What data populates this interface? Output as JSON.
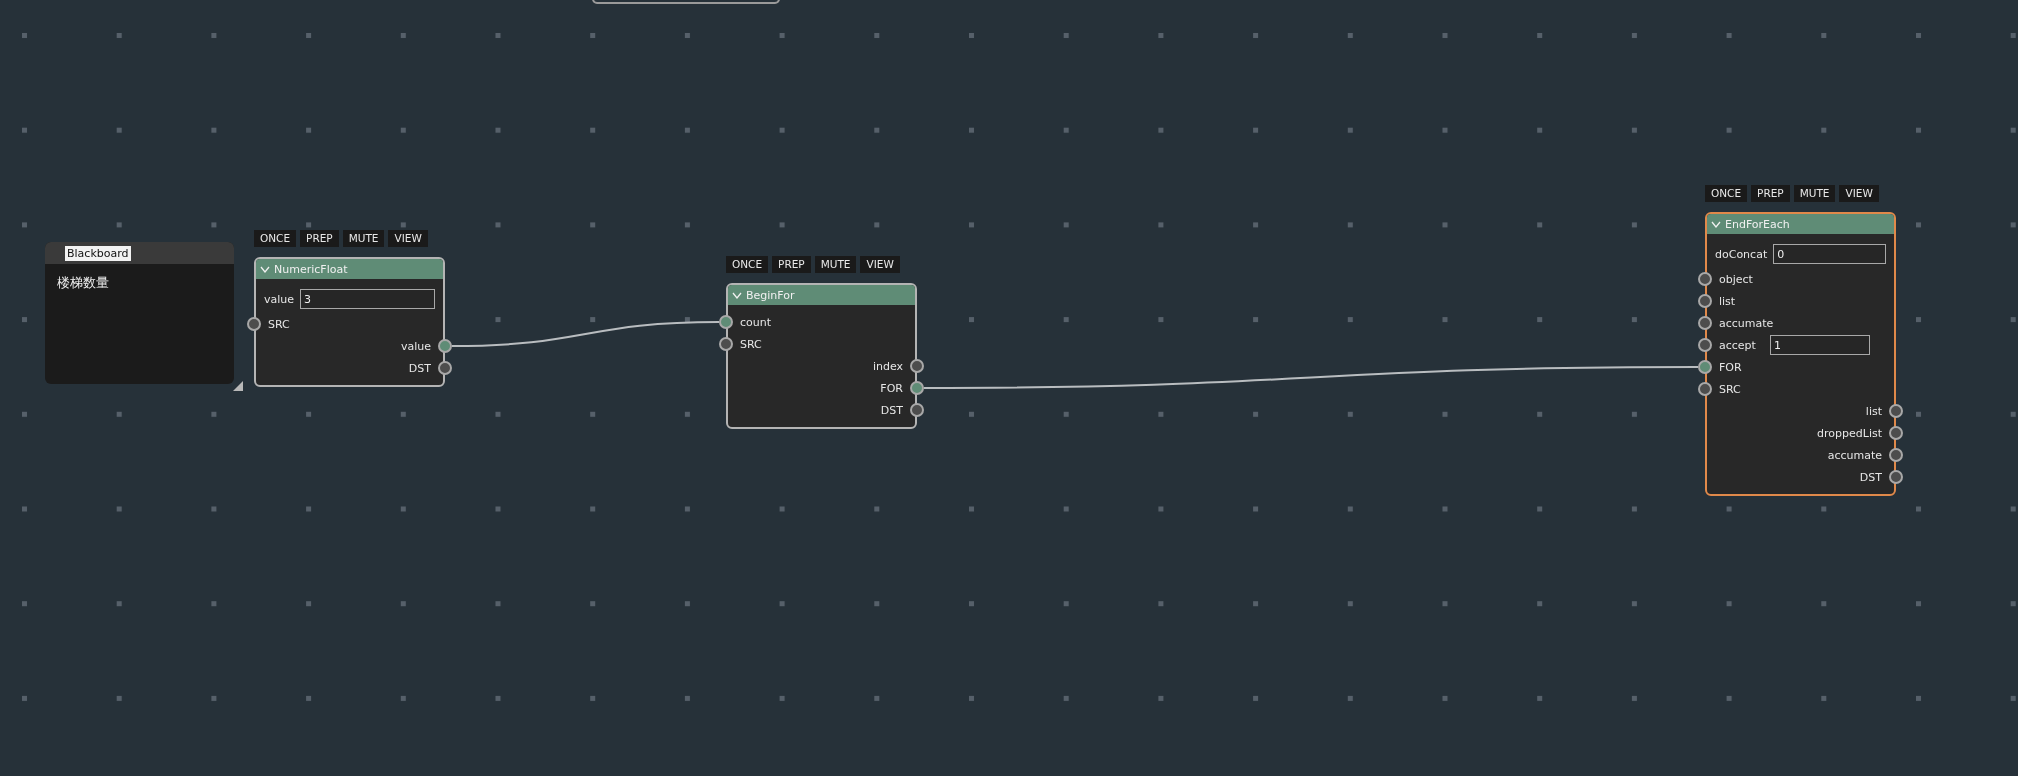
{
  "nodes": [
    {
      "kind": "blackboard",
      "title": "Blackboard",
      "text": "楼梯数量"
    },
    {
      "kind": "graph",
      "title": "NumericFloat",
      "selected": false,
      "buttons": [
        "ONCE",
        "PREP",
        "MUTE",
        "VIEW"
      ],
      "rows": [
        {
          "kind": "field",
          "label": "value",
          "value": "3"
        },
        {
          "kind": "input",
          "label": "SRC",
          "connected": false
        },
        {
          "kind": "output",
          "label": "value",
          "connected": true
        },
        {
          "kind": "output",
          "label": "DST",
          "connected": false
        }
      ]
    },
    {
      "kind": "graph",
      "title": "BeginFor",
      "selected": false,
      "buttons": [
        "ONCE",
        "PREP",
        "MUTE",
        "VIEW"
      ],
      "rows": [
        {
          "kind": "input",
          "label": "count",
          "connected": true
        },
        {
          "kind": "input",
          "label": "SRC",
          "connected": false
        },
        {
          "kind": "output",
          "label": "index",
          "connected": false
        },
        {
          "kind": "output",
          "label": "FOR",
          "connected": true
        },
        {
          "kind": "output",
          "label": "DST",
          "connected": false
        }
      ]
    },
    {
      "kind": "graph",
      "title": "EndForEach",
      "selected": true,
      "buttons": [
        "ONCE",
        "PREP",
        "MUTE",
        "VIEW"
      ],
      "rows": [
        {
          "kind": "field",
          "label": "doConcat",
          "value": "0"
        },
        {
          "kind": "input",
          "label": "object",
          "connected": false
        },
        {
          "kind": "input",
          "label": "list",
          "connected": false
        },
        {
          "kind": "input",
          "label": "accumate",
          "connected": false
        },
        {
          "kind": "input",
          "label": "accept",
          "connected": false,
          "value": "1"
        },
        {
          "kind": "input",
          "label": "FOR",
          "connected": true
        },
        {
          "kind": "input",
          "label": "SRC",
          "connected": false
        },
        {
          "kind": "output",
          "label": "list",
          "connected": false
        },
        {
          "kind": "output",
          "label": "droppedList",
          "connected": false
        },
        {
          "kind": "output",
          "label": "accumate",
          "connected": false
        },
        {
          "kind": "output",
          "label": "DST",
          "connected": false
        }
      ]
    }
  ]
}
